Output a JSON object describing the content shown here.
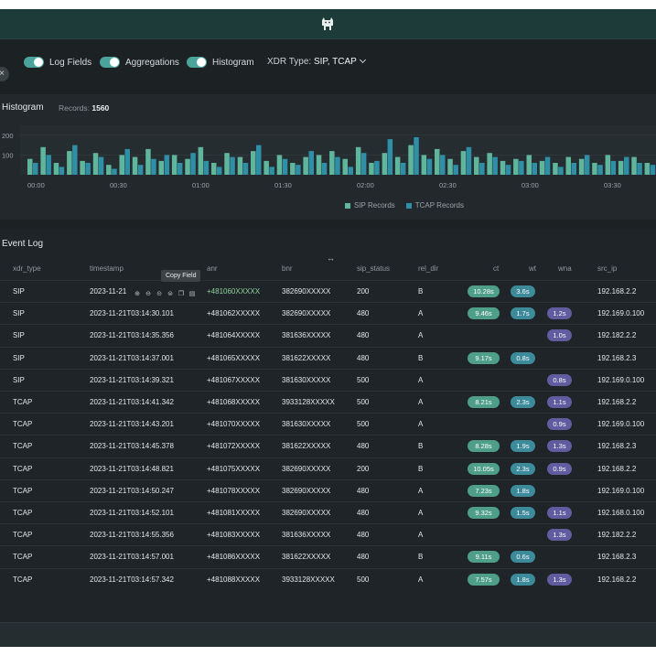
{
  "toolbar": {
    "toggles": [
      {
        "label": "Log Fields",
        "on": true
      },
      {
        "label": "Aggregations",
        "on": true
      },
      {
        "label": "Histogram",
        "on": true
      }
    ],
    "xdr_type_label": "XDR Type: ",
    "xdr_type_value": "SIP, TCAP"
  },
  "histogram": {
    "title": "Histogram",
    "records_label": "Records: ",
    "records_value": "1560",
    "y_ticks": [
      "200",
      "100"
    ],
    "x_ticks": [
      "00:00",
      "00:30",
      "01:00",
      "01:30",
      "02:00",
      "02:30",
      "03:00",
      "03:30"
    ],
    "legend": [
      "SIP Records",
      "TCAP Records"
    ],
    "colors": {
      "sip": "#5fb69c",
      "tcap": "#2f8fa6"
    }
  },
  "chart_data": {
    "type": "bar",
    "title": "Histogram",
    "series": [
      {
        "name": "SIP Records",
        "values": [
          80,
          140,
          60,
          120,
          70,
          110,
          50,
          100,
          90,
          130,
          70,
          100,
          80,
          140,
          60,
          110,
          90,
          120,
          70,
          100,
          60,
          90,
          100,
          120,
          80,
          140,
          60,
          110,
          90,
          150,
          100,
          130,
          80,
          120,
          90,
          110,
          70,
          80,
          100,
          70,
          60,
          90,
          80,
          60,
          100,
          70,
          90,
          60
        ]
      },
      {
        "name": "TCAP Records",
        "values": [
          60,
          100,
          40,
          150,
          60,
          90,
          30,
          130,
          50,
          80,
          100,
          60,
          110,
          70,
          40,
          90,
          60,
          150,
          40,
          80,
          50,
          120,
          60,
          90,
          40,
          110,
          70,
          180,
          60,
          190,
          80,
          100,
          50,
          140,
          60,
          90,
          50,
          70,
          60,
          90,
          40,
          60,
          100,
          50,
          70,
          90,
          60,
          50
        ]
      }
    ],
    "xlabel": "",
    "ylabel": "",
    "ylim": [
      0,
      250
    ],
    "legend": "bottom-center"
  },
  "event_log": {
    "title": "Event Log",
    "tooltip": "Copy Field",
    "columns": [
      "xdr_type",
      "timestamp",
      "anr",
      "bnr",
      "sip_status",
      "rel_dir",
      "ct",
      "wt",
      "wna",
      "src_ip"
    ],
    "rows": [
      {
        "xdr_type": "SIP",
        "timestamp": "2023-11-21",
        "anr": "+481060XXXXX",
        "bnr": "382690XXXXX",
        "sip_status": "200",
        "rel_dir": "B",
        "ct": "10.28s",
        "wt": "3.6s",
        "wna": "",
        "src_ip": "192.168.2.2",
        "anr_hi": true
      },
      {
        "xdr_type": "SIP",
        "timestamp": "2023-11-21T03:14:30.101",
        "anr": "+481062XXXXX",
        "bnr": "382690XXXXX",
        "sip_status": "480",
        "rel_dir": "A",
        "ct": "9.46s",
        "wt": "1.7s",
        "wna": "1.2s",
        "src_ip": "192.169.0.100"
      },
      {
        "xdr_type": "SIP",
        "timestamp": "2023-11-21T03:14:35.356",
        "anr": "+481064XXXXX",
        "bnr": "381636XXXXX",
        "sip_status": "480",
        "rel_dir": "A",
        "ct": "",
        "wt": "",
        "wna": "1.0s",
        "src_ip": "192.182.2.2"
      },
      {
        "xdr_type": "SIP",
        "timestamp": "2023-11-21T03:14:37.001",
        "anr": "+481065XXXXX",
        "bnr": "381622XXXXX",
        "sip_status": "480",
        "rel_dir": "B",
        "ct": "9.17s",
        "wt": "0.8s",
        "wna": "",
        "src_ip": "192.168.2.3"
      },
      {
        "xdr_type": "SIP",
        "timestamp": "2023-11-21T03:14:39.321",
        "anr": "+481067XXXXX",
        "bnr": "381630XXXXX",
        "sip_status": "500",
        "rel_dir": "A",
        "ct": "",
        "wt": "",
        "wna": "0.8s",
        "src_ip": "192.169.0.100"
      },
      {
        "xdr_type": "TCAP",
        "timestamp": "2023-11-21T03:14:41.342",
        "anr": "+481068XXXXX",
        "bnr": "3933128XXXXX",
        "sip_status": "500",
        "rel_dir": "A",
        "ct": "8.21s",
        "wt": "2.3s",
        "wna": "1.1s",
        "src_ip": "192.168.2.2"
      },
      {
        "xdr_type": "TCAP",
        "timestamp": "2023-11-21T03:14:43.201",
        "anr": "+481070XXXXX",
        "bnr": "381630XXXXX",
        "sip_status": "500",
        "rel_dir": "A",
        "ct": "",
        "wt": "",
        "wna": "0.9s",
        "src_ip": "192.169.0.100"
      },
      {
        "xdr_type": "TCAP",
        "timestamp": "2023-11-21T03:14:45.378",
        "anr": "+481072XXXXX",
        "bnr": "381622XXXXX",
        "sip_status": "480",
        "rel_dir": "B",
        "ct": "8.28s",
        "wt": "1.9s",
        "wna": "1.3s",
        "src_ip": "192.168.2.3"
      },
      {
        "xdr_type": "TCAP",
        "timestamp": "2023-11-21T03:14:48.821",
        "anr": "+481075XXXXX",
        "bnr": "382690XXXXX",
        "sip_status": "200",
        "rel_dir": "B",
        "ct": "10.05s",
        "wt": "2.3s",
        "wna": "0.9s",
        "src_ip": "192.168.2.2"
      },
      {
        "xdr_type": "TCAP",
        "timestamp": "2023-11-21T03:14:50.247",
        "anr": "+481078XXXXX",
        "bnr": "382690XXXXX",
        "sip_status": "480",
        "rel_dir": "A",
        "ct": "7.23s",
        "wt": "1.8s",
        "wna": "",
        "src_ip": "192.169.0.100"
      },
      {
        "xdr_type": "TCAP",
        "timestamp": "2023-11-21T03:14:52.101",
        "anr": "+481081XXXXX",
        "bnr": "382690XXXXX",
        "sip_status": "480",
        "rel_dir": "A",
        "ct": "9.32s",
        "wt": "1.5s",
        "wna": "1.1s",
        "src_ip": "192.168.0.100"
      },
      {
        "xdr_type": "TCAP",
        "timestamp": "2023-11-21T03:14:55.356",
        "anr": "+481083XXXXX",
        "bnr": "381636XXXXX",
        "sip_status": "480",
        "rel_dir": "A",
        "ct": "",
        "wt": "",
        "wna": "1.3s",
        "src_ip": "192.182.2.2"
      },
      {
        "xdr_type": "TCAP",
        "timestamp": "2023-11-21T03:14:57.001",
        "anr": "+481086XXXXX",
        "bnr": "381622XXXXX",
        "sip_status": "480",
        "rel_dir": "B",
        "ct": "9.11s",
        "wt": "0.6s",
        "wna": "",
        "src_ip": "192.168.2.3"
      },
      {
        "xdr_type": "TCAP",
        "timestamp": "2023-11-21T03:14:57.342",
        "anr": "+481088XXXXX",
        "bnr": "3933128XXXXX",
        "sip_status": "500",
        "rel_dir": "A",
        "ct": "7.57s",
        "wt": "1.8s",
        "wna": "1.3s",
        "src_ip": "192.168.2.2"
      }
    ]
  }
}
